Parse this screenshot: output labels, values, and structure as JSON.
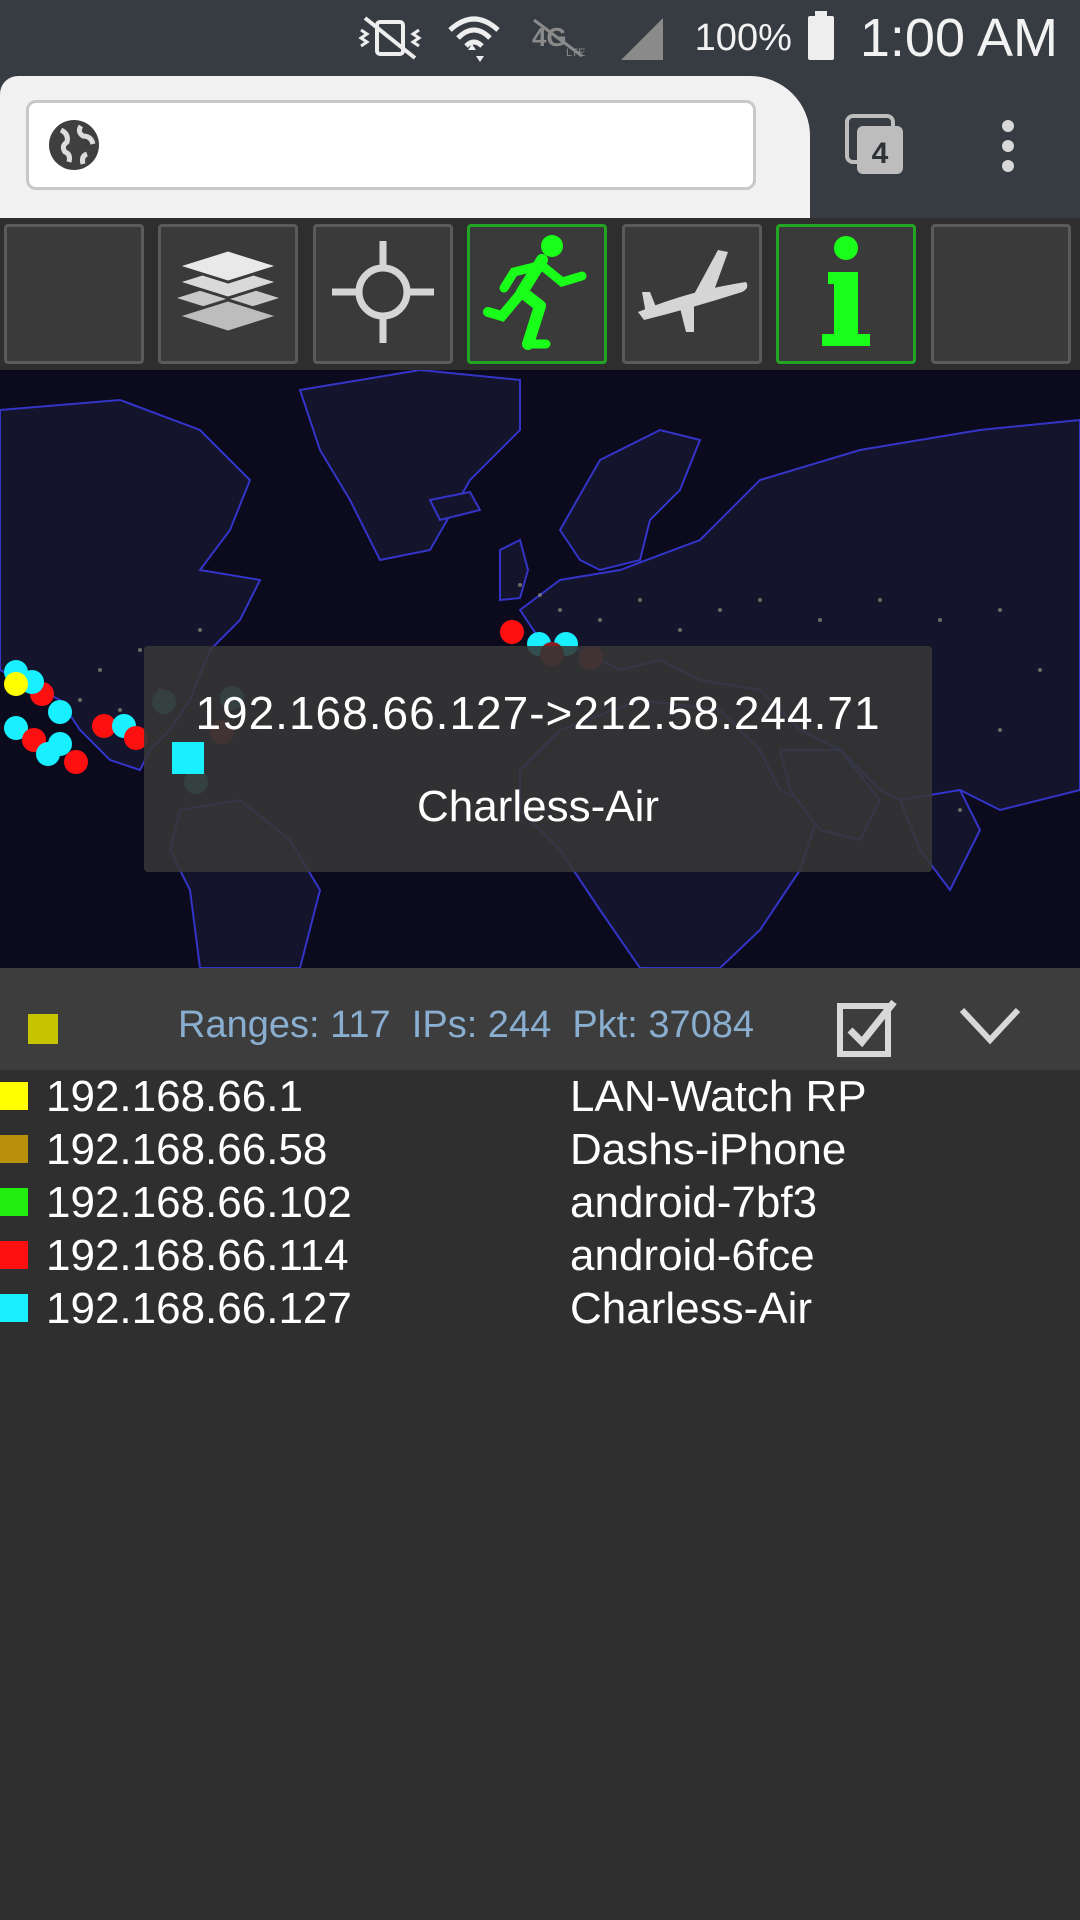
{
  "status_bar": {
    "battery_percent": "100%",
    "time": "1:00 AM",
    "icons": [
      "vibrate-off-icon",
      "wifi-icon",
      "4g-lte-icon",
      "signal-icon",
      "battery-icon"
    ]
  },
  "browser": {
    "url_value": "",
    "tab_count": "4",
    "icons": [
      "globe-icon",
      "tabs-icon",
      "overflow-menu-icon"
    ]
  },
  "toolbar": {
    "buttons": [
      {
        "name": "blank",
        "active": false
      },
      {
        "name": "layers-icon",
        "active": false
      },
      {
        "name": "locate-icon",
        "active": false
      },
      {
        "name": "running-man-icon",
        "active": true
      },
      {
        "name": "airplane-icon",
        "active": false
      },
      {
        "name": "info-icon",
        "active": true
      },
      {
        "name": "blank",
        "active": false
      }
    ]
  },
  "map": {
    "popup": {
      "route": "192.168.66.127->212.58.244.71",
      "host": "Charless-Air"
    },
    "marker_colors": {
      "cyan": "#18f0ff",
      "red": "#ff1010",
      "yellow": "#ffff00",
      "dark_cyan": "#2a8f8f",
      "dark_red": "#8a1f1f"
    }
  },
  "summary": {
    "stats": "Ranges: 117  IPs: 244  Pkt: 37084",
    "legend_color": "#c6c400"
  },
  "hosts": [
    {
      "ip": "192.168.66.1",
      "name": "LAN-Watch RP",
      "color": "#ffff00"
    },
    {
      "ip": "192.168.66.58",
      "name": "Dashs-iPhone",
      "color": "#b8900a"
    },
    {
      "ip": "192.168.66.102",
      "name": "android-7bf3",
      "color": "#22ee10"
    },
    {
      "ip": "192.168.66.114",
      "name": "android-6fce",
      "color": "#ff1010"
    },
    {
      "ip": "192.168.66.127",
      "name": "Charless-Air",
      "color": "#18f0ff"
    }
  ]
}
